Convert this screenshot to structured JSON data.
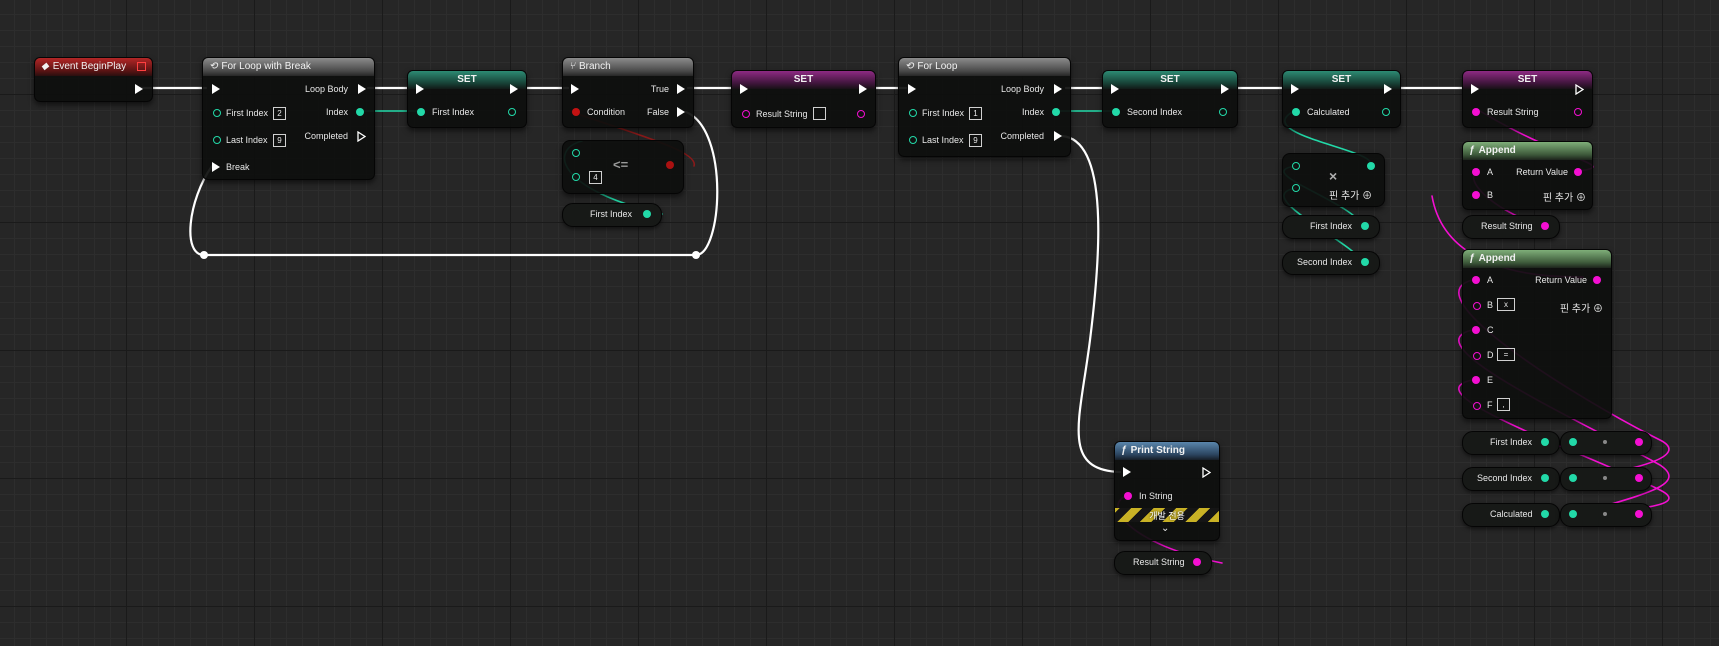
{
  "nodes": {
    "event_begin_play": {
      "title": "Event BeginPlay"
    },
    "for_loop_break": {
      "title": "For Loop with Break",
      "loop_body": "Loop Body",
      "index": "Index",
      "completed": "Completed",
      "first_index": "First Index",
      "first_value": "2",
      "last_index": "Last Index",
      "last_value": "9",
      "break": "Break"
    },
    "set_first_index": {
      "title": "SET",
      "pin": "First Index"
    },
    "branch": {
      "title": "Branch",
      "true": "True",
      "false": "False",
      "condition": "Condition"
    },
    "lte": {
      "op": "<=",
      "value": "4"
    },
    "var_first_index_1": {
      "label": "First Index"
    },
    "set_result_string_1": {
      "title": "SET",
      "pin": "Result String",
      "value": ""
    },
    "for_loop": {
      "title": "For Loop",
      "loop_body": "Loop Body",
      "index": "Index",
      "completed": "Completed",
      "first_index": "First Index",
      "first_value": "1",
      "last_index": "Last Index",
      "last_value": "9"
    },
    "set_second_index": {
      "title": "SET",
      "pin": "Second Index"
    },
    "set_calculated": {
      "title": "SET",
      "pin": "Calculated"
    },
    "multiply": {
      "op": "×",
      "add_pin": "핀 추가"
    },
    "var_first_index_2": {
      "label": "First Index"
    },
    "var_second_index_1": {
      "label": "Second Index"
    },
    "set_result_string_2": {
      "title": "SET",
      "pin": "Result String"
    },
    "append_1": {
      "title": "Append",
      "a": "A",
      "b": "B",
      "return_value": "Return Value",
      "add_pin": "핀 추가"
    },
    "var_result_string_1": {
      "label": "Result String"
    },
    "append_2": {
      "title": "Append",
      "a": "A",
      "b": "B",
      "b_value": "x",
      "c": "C",
      "d": "D",
      "d_value": "=",
      "e": "E",
      "f": "F",
      "f_value": ",",
      "return_value": "Return Value",
      "add_pin": "핀 추가"
    },
    "var_first_index_3": {
      "label": "First Index"
    },
    "var_second_index_2": {
      "label": "Second Index"
    },
    "var_calculated": {
      "label": "Calculated"
    },
    "print_string": {
      "title": "Print String",
      "in_string": "In String",
      "dev_only": "개발 전용"
    },
    "var_result_string_2": {
      "label": "Result String"
    }
  },
  "colors": {
    "exec_wire": "#ffffff",
    "int_pin": "#22d9a8",
    "string_pin": "#f40fd2",
    "bool_pin": "#c41212",
    "event_header": "#b32626",
    "set_int_header": "#2d8b74",
    "set_string_header": "#8e2a84",
    "function_header": "#7fae79",
    "print_header": "#5a86ac"
  },
  "icons": {
    "event": "event-diamond-icon",
    "loop": "loop-icon",
    "branch": "branch-icon",
    "function": "function-icon",
    "add_pin": "add-pin-icon",
    "expand": "chevron-down-icon"
  }
}
